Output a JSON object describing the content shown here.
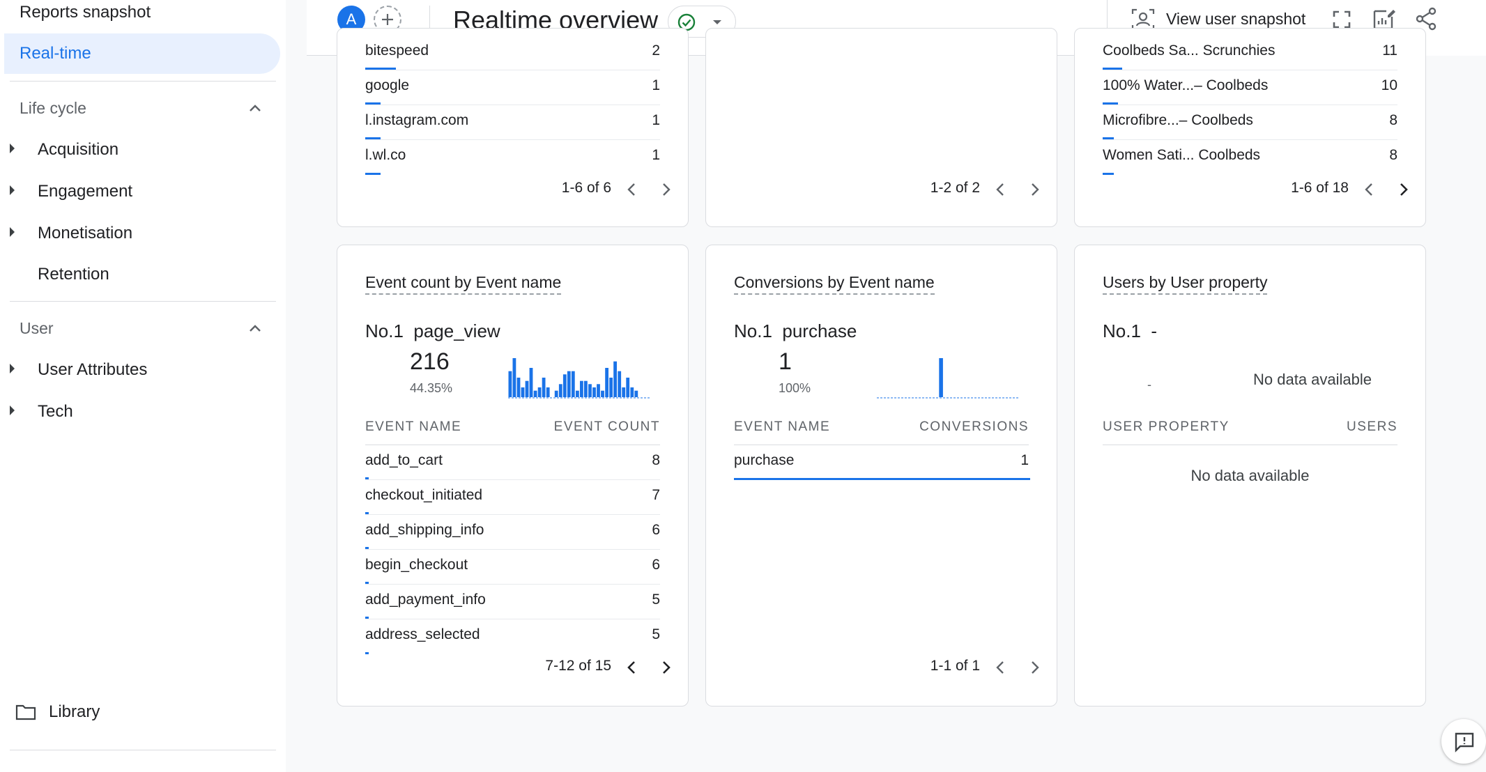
{
  "sidebar": {
    "top_item": "Reports snapshot",
    "active_item": "Real-time",
    "lifecycle": {
      "title": "Life cycle",
      "items": [
        "Acquisition",
        "Engagement",
        "Monetisation",
        "Retention"
      ]
    },
    "user": {
      "title": "User",
      "items": [
        "User Attributes",
        "Tech"
      ]
    },
    "library": "Library"
  },
  "header": {
    "avatar_letter": "A",
    "title": "Realtime overview",
    "snapshot_label": "View user snapshot"
  },
  "top_cards": {
    "left": {
      "partial_row": {
        "name": "bitespeed",
        "value": "2"
      },
      "rows": [
        {
          "name": "google",
          "value": "1",
          "fraction": 0.1
        },
        {
          "name": "l.instagram.com",
          "value": "1",
          "fraction": 0.05
        },
        {
          "name": "l.wl.co",
          "value": "1",
          "fraction": 0.05
        }
      ],
      "pager": "1-6 of 6"
    },
    "middle": {
      "pager": "1-2 of 2"
    },
    "right": {
      "partial_row": {
        "name": "Coolbeds Sa... Scrunchies",
        "value": "11"
      },
      "rows": [
        {
          "name": "100% Water...– Coolbeds",
          "value": "10",
          "fraction": 0.06
        },
        {
          "name": "Microfibre...– Coolbeds",
          "value": "8",
          "fraction": 0.04
        },
        {
          "name": "Women Sati... Coolbeds",
          "value": "8",
          "fraction": 0.04
        }
      ],
      "pager": "1-6 of 18"
    }
  },
  "event_card": {
    "title": "Event count by Event name",
    "rank": "No.1",
    "top_name": "page_view",
    "top_value": "216",
    "top_pct": "44.35%",
    "col_name": "EVENT NAME",
    "col_value": "EVENT COUNT",
    "rows": [
      {
        "name": "add_to_cart",
        "value": "8",
        "fraction": 0.01
      },
      {
        "name": "checkout_initiated",
        "value": "7",
        "fraction": 0.01
      },
      {
        "name": "add_shipping_info",
        "value": "6",
        "fraction": 0.01
      },
      {
        "name": "begin_checkout",
        "value": "6",
        "fraction": 0.01
      },
      {
        "name": "add_payment_info",
        "value": "5",
        "fraction": 0.01
      },
      {
        "name": "address_selected",
        "value": "5",
        "fraction": 0.01
      }
    ],
    "pager": "7-12 of 15",
    "chart_data": {
      "type": "bar",
      "values": [
        8,
        12,
        6,
        3,
        5,
        9,
        2,
        3,
        6,
        3,
        0,
        2,
        4,
        7,
        8,
        8,
        2,
        5,
        5,
        4,
        3,
        4,
        2,
        9,
        6,
        11,
        8,
        3,
        6,
        3,
        2,
        0,
        0,
        0
      ]
    }
  },
  "conversions_card": {
    "title": "Conversions by Event name",
    "rank": "No.1",
    "top_name": "purchase",
    "top_value": "1",
    "top_pct": "100%",
    "col_name": "EVENT NAME",
    "col_value": "CONVERSIONS",
    "rows": [
      {
        "name": "purchase",
        "value": "1",
        "fraction": 1.0
      }
    ],
    "pager": "1-1 of 1",
    "chart_data": {
      "type": "bar",
      "values": [
        0,
        0,
        0,
        0,
        0,
        0,
        0,
        0,
        0,
        0,
        0,
        0,
        0,
        1,
        0,
        0,
        0,
        0,
        0,
        0,
        0,
        0,
        0,
        0,
        0,
        0,
        0,
        0,
        0,
        0
      ]
    }
  },
  "user_property_card": {
    "title": "Users by User property",
    "rank": "No.1",
    "top_name": "-",
    "top_dash": "-",
    "no_data_top": "No data available",
    "col_name": "USER PROPERTY",
    "col_value": "USERS",
    "no_data_table": "No data available"
  },
  "colors": {
    "accent": "#1a73e8",
    "success": "#188038",
    "border": "#dadce0"
  }
}
